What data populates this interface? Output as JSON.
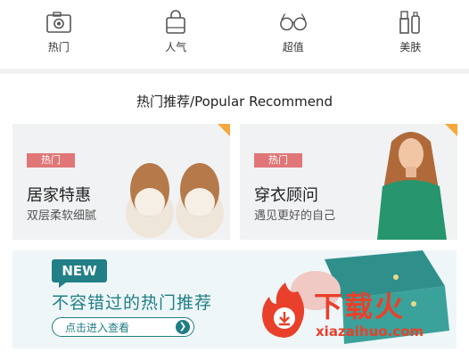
{
  "nav": {
    "items": [
      {
        "label": "热门",
        "icon": "camera-icon"
      },
      {
        "label": "人气",
        "icon": "shopping-bag-icon"
      },
      {
        "label": "超值",
        "icon": "glasses-icon"
      },
      {
        "label": "美肤",
        "icon": "cosmetics-icon"
      }
    ]
  },
  "section": {
    "title": "热门推荐/Popular Recommend"
  },
  "cards": [
    {
      "badge": "热门",
      "title": "居家特惠",
      "subtitle": "双层柔软细腻",
      "image": "slippers-image"
    },
    {
      "badge": "热门",
      "title": "穿衣顾问",
      "subtitle": "遇见更好的自己",
      "image": "model-image"
    }
  ],
  "banner": {
    "tag": "NEW",
    "title": "不容错过的热门推荐",
    "button_label": "点击进入查看",
    "image": "bedding-image"
  },
  "watermark": {
    "cn": "下载火",
    "en": "xiazaihuo.com"
  },
  "colors": {
    "badge": "#e07677",
    "corner": "#f7a83a",
    "teal": "#1f7e84",
    "watermark": "#e8402b"
  }
}
